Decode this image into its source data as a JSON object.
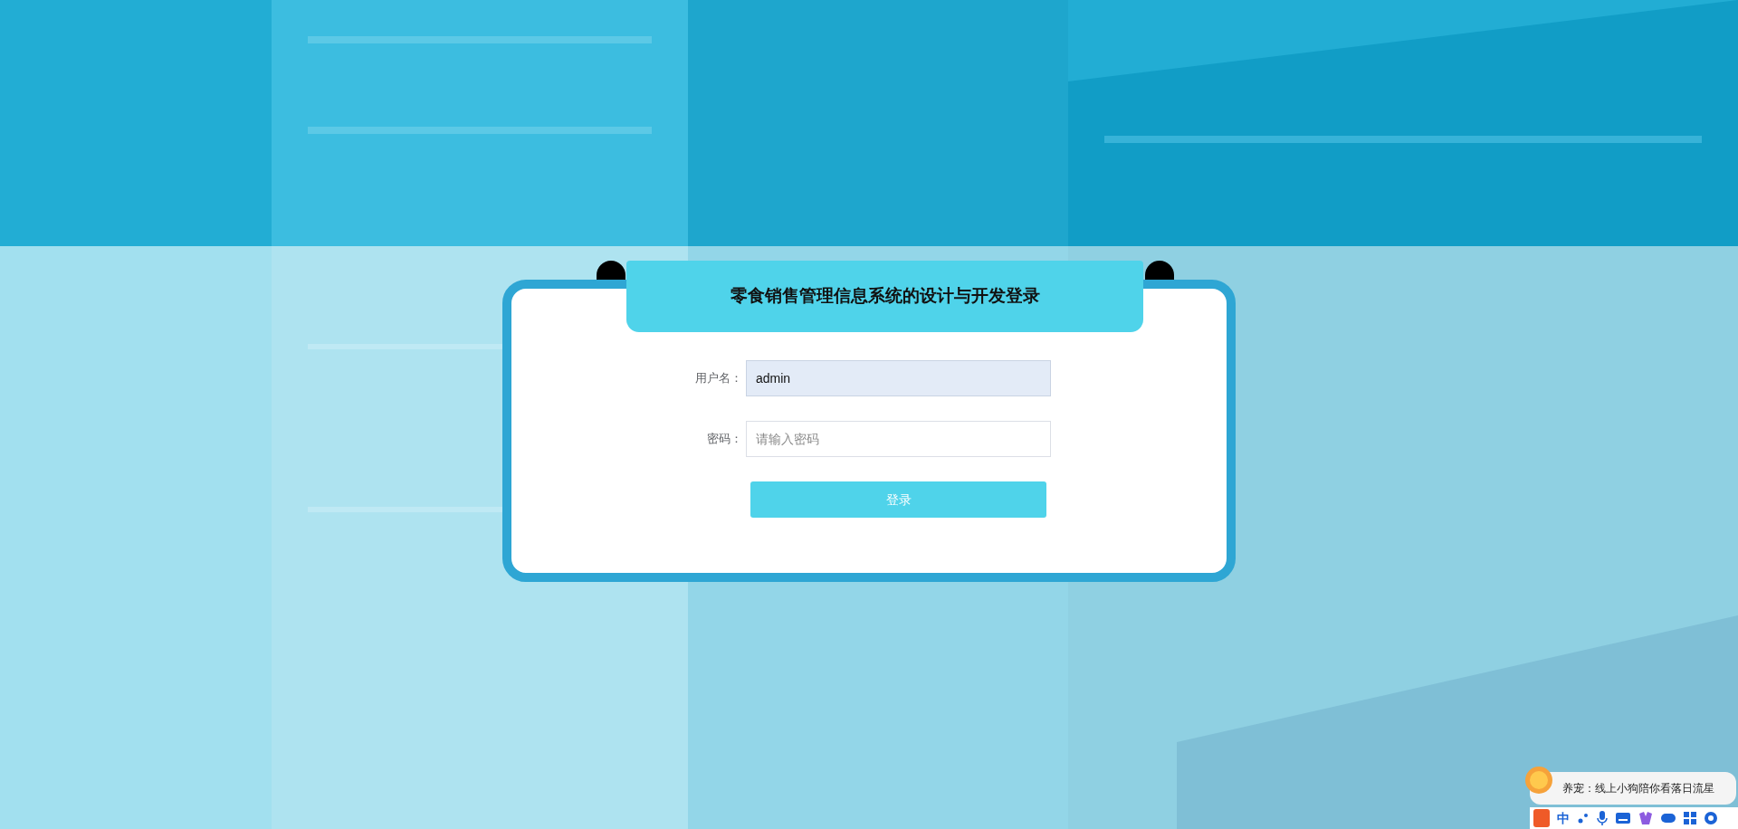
{
  "title": "零食销售管理信息系统的设计与开发登录",
  "fields": [
    {
      "label": "用户名：",
      "value": "admin",
      "focused": true
    },
    {
      "label": "密码：",
      "placeholder": "请输入密码",
      "focused": false
    }
  ],
  "login_button": "登录",
  "ime_toolbar": {
    "tip": "养宠：线上小狗陪你看落日流星",
    "mode": "中"
  }
}
